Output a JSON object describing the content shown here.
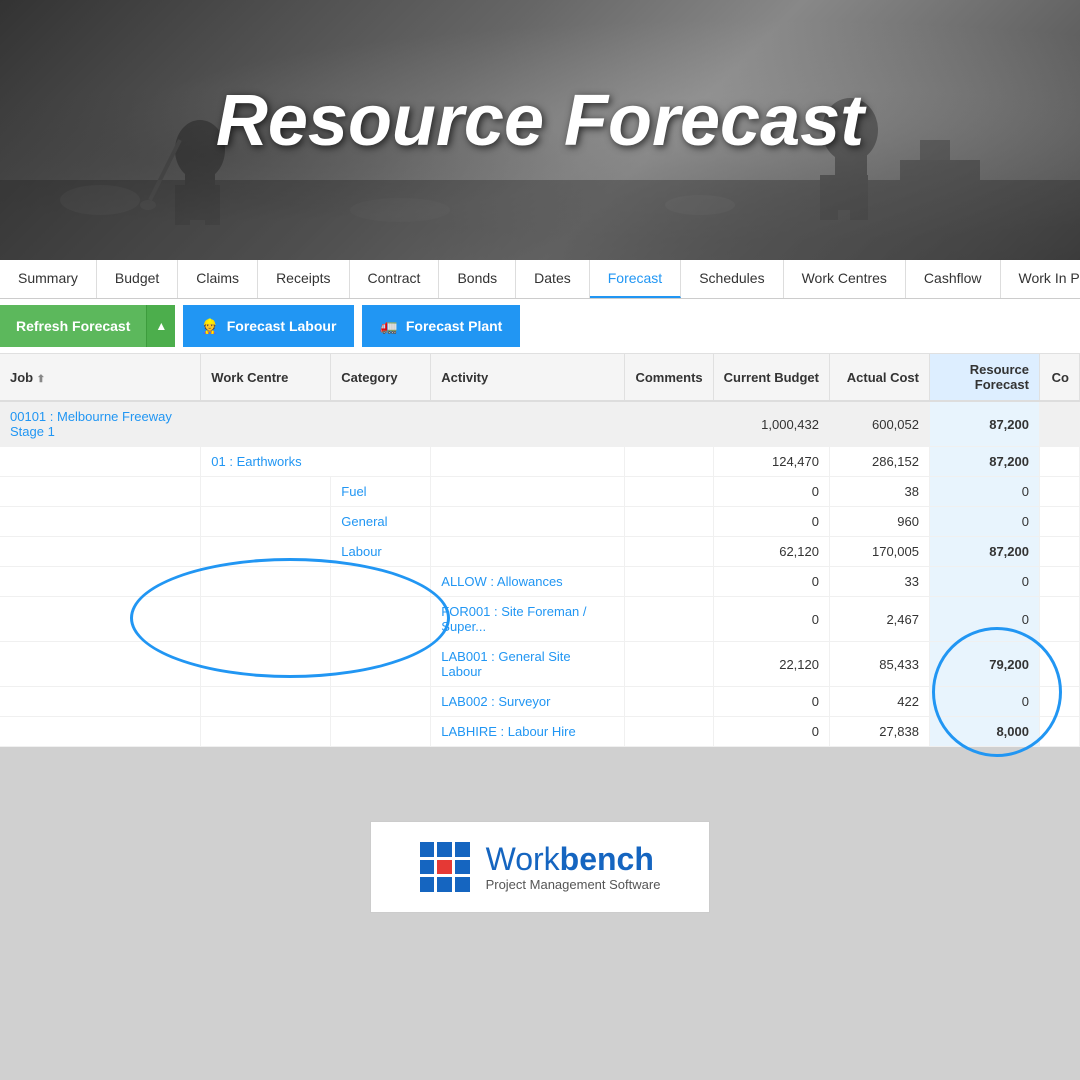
{
  "hero": {
    "title": "Resource Forecast",
    "bg_description": "construction workers background grayscale"
  },
  "nav": {
    "tabs": [
      {
        "label": "Summary",
        "active": false
      },
      {
        "label": "Budget",
        "active": false
      },
      {
        "label": "Claims",
        "active": false
      },
      {
        "label": "Receipts",
        "active": false
      },
      {
        "label": "Contract",
        "active": false
      },
      {
        "label": "Bonds",
        "active": false
      },
      {
        "label": "Dates",
        "active": false
      },
      {
        "label": "Forecast",
        "active": true
      },
      {
        "label": "Schedules",
        "active": false
      },
      {
        "label": "Work Centres",
        "active": false
      },
      {
        "label": "Cashflow",
        "active": false
      },
      {
        "label": "Work In Progress",
        "active": false
      }
    ]
  },
  "toolbar": {
    "refresh_label": "Refresh Forecast",
    "forecast_labour_label": "Forecast Labour",
    "forecast_plant_label": "Forecast Plant",
    "labour_icon": "👷",
    "plant_icon": "🚛"
  },
  "table": {
    "headers": [
      {
        "label": "Job",
        "sort": true
      },
      {
        "label": "Work Centre",
        "sort": false
      },
      {
        "label": "Category",
        "sort": false
      },
      {
        "label": "Activity",
        "sort": false
      },
      {
        "label": "Comments",
        "sort": false
      },
      {
        "label": "Current Budget",
        "sort": false
      },
      {
        "label": "Actual Cost",
        "sort": false
      },
      {
        "label": "Resource Forecast",
        "sort": false
      },
      {
        "label": "Co",
        "sort": false
      }
    ],
    "rows": [
      {
        "type": "job",
        "job": "00101 : Melbourne Freeway Stage 1",
        "work_centre": "",
        "category": "",
        "activity": "",
        "comments": "",
        "current_budget": "1,000,432",
        "actual_cost": "600,052",
        "resource_forecast": "87,200",
        "co": ""
      },
      {
        "type": "work_centre",
        "job": "",
        "work_centre": "01 : Earthworks",
        "category": "",
        "activity": "",
        "comments": "",
        "current_budget": "124,470",
        "actual_cost": "286,152",
        "resource_forecast": "87,200",
        "co": ""
      },
      {
        "type": "category",
        "job": "",
        "work_centre": "",
        "category": "Fuel",
        "activity": "",
        "comments": "",
        "current_budget": "0",
        "actual_cost": "38",
        "resource_forecast": "0",
        "co": ""
      },
      {
        "type": "category",
        "job": "",
        "work_centre": "",
        "category": "General",
        "activity": "",
        "comments": "",
        "current_budget": "0",
        "actual_cost": "960",
        "resource_forecast": "0",
        "co": ""
      },
      {
        "type": "category",
        "job": "",
        "work_centre": "",
        "category": "Labour",
        "activity": "",
        "comments": "",
        "current_budget": "62,120",
        "actual_cost": "170,005",
        "resource_forecast": "87,200",
        "co": ""
      },
      {
        "type": "activity",
        "job": "",
        "work_centre": "",
        "category": "",
        "activity": "ALLOW : Allowances",
        "comments": "",
        "current_budget": "0",
        "actual_cost": "33",
        "resource_forecast": "0",
        "co": ""
      },
      {
        "type": "activity",
        "job": "",
        "work_centre": "",
        "category": "",
        "activity": "FOR001 : Site Foreman / Super...",
        "comments": "",
        "current_budget": "0",
        "actual_cost": "2,467",
        "resource_forecast": "0",
        "co": ""
      },
      {
        "type": "activity",
        "job": "",
        "work_centre": "",
        "category": "",
        "activity": "LAB001 : General Site Labour",
        "comments": "",
        "current_budget": "22,120",
        "actual_cost": "85,433",
        "resource_forecast": "79,200",
        "co": ""
      },
      {
        "type": "activity",
        "job": "",
        "work_centre": "",
        "category": "",
        "activity": "LAB002 : Surveyor",
        "comments": "",
        "current_budget": "0",
        "actual_cost": "422",
        "resource_forecast": "0",
        "co": ""
      },
      {
        "type": "activity",
        "job": "",
        "work_centre": "",
        "category": "",
        "activity": "LABHIRE : Labour Hire",
        "comments": "",
        "current_budget": "0",
        "actual_cost": "27,838",
        "resource_forecast": "8,000",
        "co": ""
      }
    ]
  },
  "logo": {
    "name_regular": "Work",
    "name_bold": "bench",
    "subtitle": "Project Management Software",
    "grid_colors": [
      "#1565c0",
      "#1565c0",
      "#1565c0",
      "#1565c0",
      "#e53935",
      "#1565c0",
      "#1565c0",
      "#1565c0",
      "#1565c0"
    ]
  }
}
